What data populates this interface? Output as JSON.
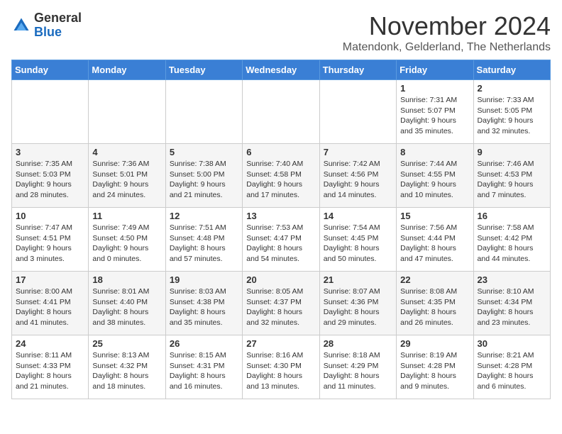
{
  "header": {
    "logo_general": "General",
    "logo_blue": "Blue",
    "month_title": "November 2024",
    "subtitle": "Matendonk, Gelderland, The Netherlands"
  },
  "days_of_week": [
    "Sunday",
    "Monday",
    "Tuesday",
    "Wednesday",
    "Thursday",
    "Friday",
    "Saturday"
  ],
  "weeks": [
    [
      {
        "day": "",
        "info": ""
      },
      {
        "day": "",
        "info": ""
      },
      {
        "day": "",
        "info": ""
      },
      {
        "day": "",
        "info": ""
      },
      {
        "day": "",
        "info": ""
      },
      {
        "day": "1",
        "info": "Sunrise: 7:31 AM\nSunset: 5:07 PM\nDaylight: 9 hours and 35 minutes."
      },
      {
        "day": "2",
        "info": "Sunrise: 7:33 AM\nSunset: 5:05 PM\nDaylight: 9 hours and 32 minutes."
      }
    ],
    [
      {
        "day": "3",
        "info": "Sunrise: 7:35 AM\nSunset: 5:03 PM\nDaylight: 9 hours and 28 minutes."
      },
      {
        "day": "4",
        "info": "Sunrise: 7:36 AM\nSunset: 5:01 PM\nDaylight: 9 hours and 24 minutes."
      },
      {
        "day": "5",
        "info": "Sunrise: 7:38 AM\nSunset: 5:00 PM\nDaylight: 9 hours and 21 minutes."
      },
      {
        "day": "6",
        "info": "Sunrise: 7:40 AM\nSunset: 4:58 PM\nDaylight: 9 hours and 17 minutes."
      },
      {
        "day": "7",
        "info": "Sunrise: 7:42 AM\nSunset: 4:56 PM\nDaylight: 9 hours and 14 minutes."
      },
      {
        "day": "8",
        "info": "Sunrise: 7:44 AM\nSunset: 4:55 PM\nDaylight: 9 hours and 10 minutes."
      },
      {
        "day": "9",
        "info": "Sunrise: 7:46 AM\nSunset: 4:53 PM\nDaylight: 9 hours and 7 minutes."
      }
    ],
    [
      {
        "day": "10",
        "info": "Sunrise: 7:47 AM\nSunset: 4:51 PM\nDaylight: 9 hours and 3 minutes."
      },
      {
        "day": "11",
        "info": "Sunrise: 7:49 AM\nSunset: 4:50 PM\nDaylight: 9 hours and 0 minutes."
      },
      {
        "day": "12",
        "info": "Sunrise: 7:51 AM\nSunset: 4:48 PM\nDaylight: 8 hours and 57 minutes."
      },
      {
        "day": "13",
        "info": "Sunrise: 7:53 AM\nSunset: 4:47 PM\nDaylight: 8 hours and 54 minutes."
      },
      {
        "day": "14",
        "info": "Sunrise: 7:54 AM\nSunset: 4:45 PM\nDaylight: 8 hours and 50 minutes."
      },
      {
        "day": "15",
        "info": "Sunrise: 7:56 AM\nSunset: 4:44 PM\nDaylight: 8 hours and 47 minutes."
      },
      {
        "day": "16",
        "info": "Sunrise: 7:58 AM\nSunset: 4:42 PM\nDaylight: 8 hours and 44 minutes."
      }
    ],
    [
      {
        "day": "17",
        "info": "Sunrise: 8:00 AM\nSunset: 4:41 PM\nDaylight: 8 hours and 41 minutes."
      },
      {
        "day": "18",
        "info": "Sunrise: 8:01 AM\nSunset: 4:40 PM\nDaylight: 8 hours and 38 minutes."
      },
      {
        "day": "19",
        "info": "Sunrise: 8:03 AM\nSunset: 4:38 PM\nDaylight: 8 hours and 35 minutes."
      },
      {
        "day": "20",
        "info": "Sunrise: 8:05 AM\nSunset: 4:37 PM\nDaylight: 8 hours and 32 minutes."
      },
      {
        "day": "21",
        "info": "Sunrise: 8:07 AM\nSunset: 4:36 PM\nDaylight: 8 hours and 29 minutes."
      },
      {
        "day": "22",
        "info": "Sunrise: 8:08 AM\nSunset: 4:35 PM\nDaylight: 8 hours and 26 minutes."
      },
      {
        "day": "23",
        "info": "Sunrise: 8:10 AM\nSunset: 4:34 PM\nDaylight: 8 hours and 23 minutes."
      }
    ],
    [
      {
        "day": "24",
        "info": "Sunrise: 8:11 AM\nSunset: 4:33 PM\nDaylight: 8 hours and 21 minutes."
      },
      {
        "day": "25",
        "info": "Sunrise: 8:13 AM\nSunset: 4:32 PM\nDaylight: 8 hours and 18 minutes."
      },
      {
        "day": "26",
        "info": "Sunrise: 8:15 AM\nSunset: 4:31 PM\nDaylight: 8 hours and 16 minutes."
      },
      {
        "day": "27",
        "info": "Sunrise: 8:16 AM\nSunset: 4:30 PM\nDaylight: 8 hours and 13 minutes."
      },
      {
        "day": "28",
        "info": "Sunrise: 8:18 AM\nSunset: 4:29 PM\nDaylight: 8 hours and 11 minutes."
      },
      {
        "day": "29",
        "info": "Sunrise: 8:19 AM\nSunset: 4:28 PM\nDaylight: 8 hours and 9 minutes."
      },
      {
        "day": "30",
        "info": "Sunrise: 8:21 AM\nSunset: 4:28 PM\nDaylight: 8 hours and 6 minutes."
      }
    ]
  ]
}
